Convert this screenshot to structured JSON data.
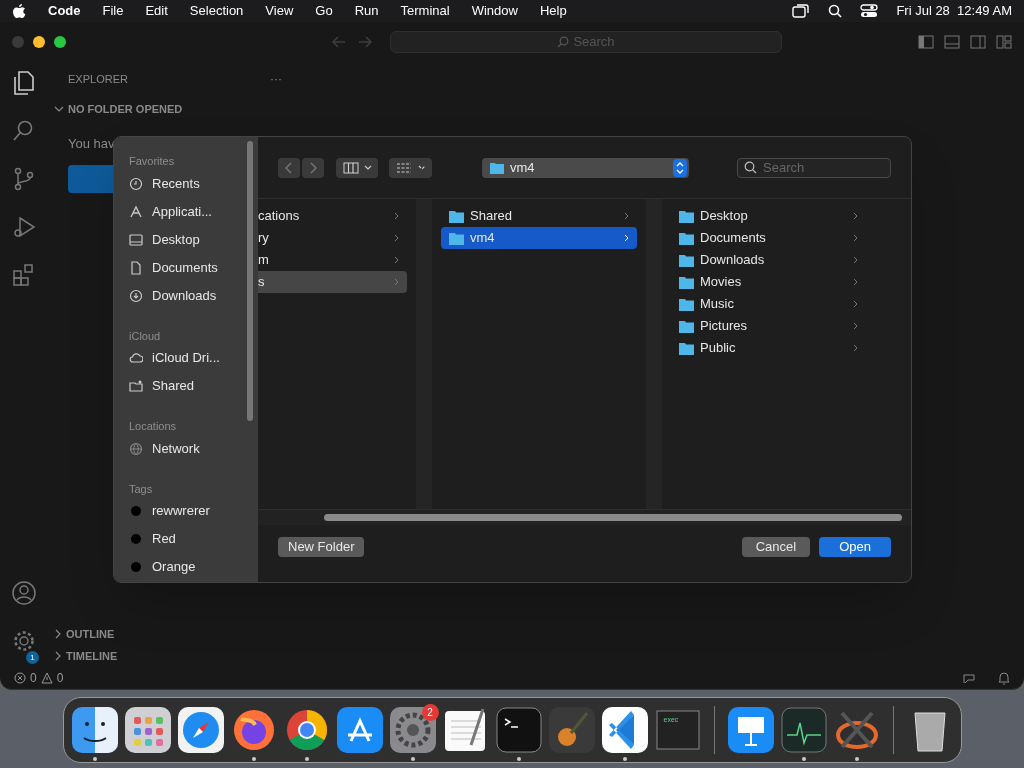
{
  "menubar": {
    "app": "Code",
    "items": [
      "File",
      "Edit",
      "Selection",
      "View",
      "Go",
      "Run",
      "Terminal",
      "Window",
      "Help"
    ],
    "clock": "Fri Jul 28  12:49 AM"
  },
  "editor": {
    "search_placeholder": "Search",
    "explorer_title": "EXPLORER",
    "more": "···",
    "section": "NO FOLDER OPENED",
    "message": "You hav",
    "panels": [
      "OUTLINE",
      "TIMELINE"
    ],
    "errors": "0",
    "warnings": "0",
    "settings_badge": "1"
  },
  "dialog": {
    "sidebar": [
      {
        "heading": "Favorites",
        "items": [
          {
            "label": "Recents",
            "kind": "clock"
          },
          {
            "label": "Applicati...",
            "kind": "apps"
          },
          {
            "label": "Desktop",
            "kind": "desktop"
          },
          {
            "label": "Documents",
            "kind": "document"
          },
          {
            "label": "Downloads",
            "kind": "download"
          }
        ]
      },
      {
        "heading": "iCloud",
        "items": [
          {
            "label": "iCloud Dri...",
            "kind": "cloud"
          },
          {
            "label": "Shared",
            "kind": "shared"
          }
        ]
      },
      {
        "heading": "Locations",
        "items": [
          {
            "label": "Network",
            "kind": "globe"
          }
        ]
      },
      {
        "heading": "Tags",
        "items": [
          {
            "label": "rewwrerer",
            "kind": "tag"
          },
          {
            "label": "Red",
            "kind": "tag"
          },
          {
            "label": "Orange",
            "kind": "tag"
          }
        ]
      }
    ],
    "location": "vm4",
    "search_placeholder": "Search",
    "columns": [
      [
        {
          "label": "cations",
          "selected": false
        },
        {
          "label": "ry",
          "selected": false
        },
        {
          "label": "m",
          "selected": false
        },
        {
          "label": "s",
          "selected": true
        }
      ],
      [
        {
          "label": "Shared",
          "selected": false
        },
        {
          "label": "vm4",
          "selected": true
        }
      ],
      [
        {
          "label": "Desktop",
          "selected": false
        },
        {
          "label": "Documents",
          "selected": false
        },
        {
          "label": "Downloads",
          "selected": false
        },
        {
          "label": "Movies",
          "selected": false
        },
        {
          "label": "Music",
          "selected": false
        },
        {
          "label": "Pictures",
          "selected": false
        },
        {
          "label": "Public",
          "selected": false
        }
      ]
    ],
    "buttons": {
      "new_folder": "New Folder",
      "cancel": "Cancel",
      "open": "Open"
    }
  },
  "dock": [
    {
      "kind": "finder",
      "running": true
    },
    {
      "kind": "launchpad",
      "running": false
    },
    {
      "kind": "safari",
      "running": false
    },
    {
      "kind": "firefox",
      "running": true
    },
    {
      "kind": "chrome",
      "running": true
    },
    {
      "kind": "appstore",
      "running": false
    },
    {
      "kind": "settings",
      "running": true,
      "badge": "2"
    },
    {
      "kind": "textedit",
      "running": false
    },
    {
      "kind": "terminal",
      "running": true
    },
    {
      "kind": "garageband",
      "running": false
    },
    {
      "kind": "vscode",
      "running": true
    },
    {
      "kind": "console",
      "running": false,
      "label": "exec"
    },
    {
      "kind": "separator"
    },
    {
      "kind": "keynote",
      "running": false
    },
    {
      "kind": "monitor",
      "running": true
    },
    {
      "kind": "xquartz",
      "running": true
    },
    {
      "kind": "separator"
    },
    {
      "kind": "trash",
      "running": false
    }
  ]
}
